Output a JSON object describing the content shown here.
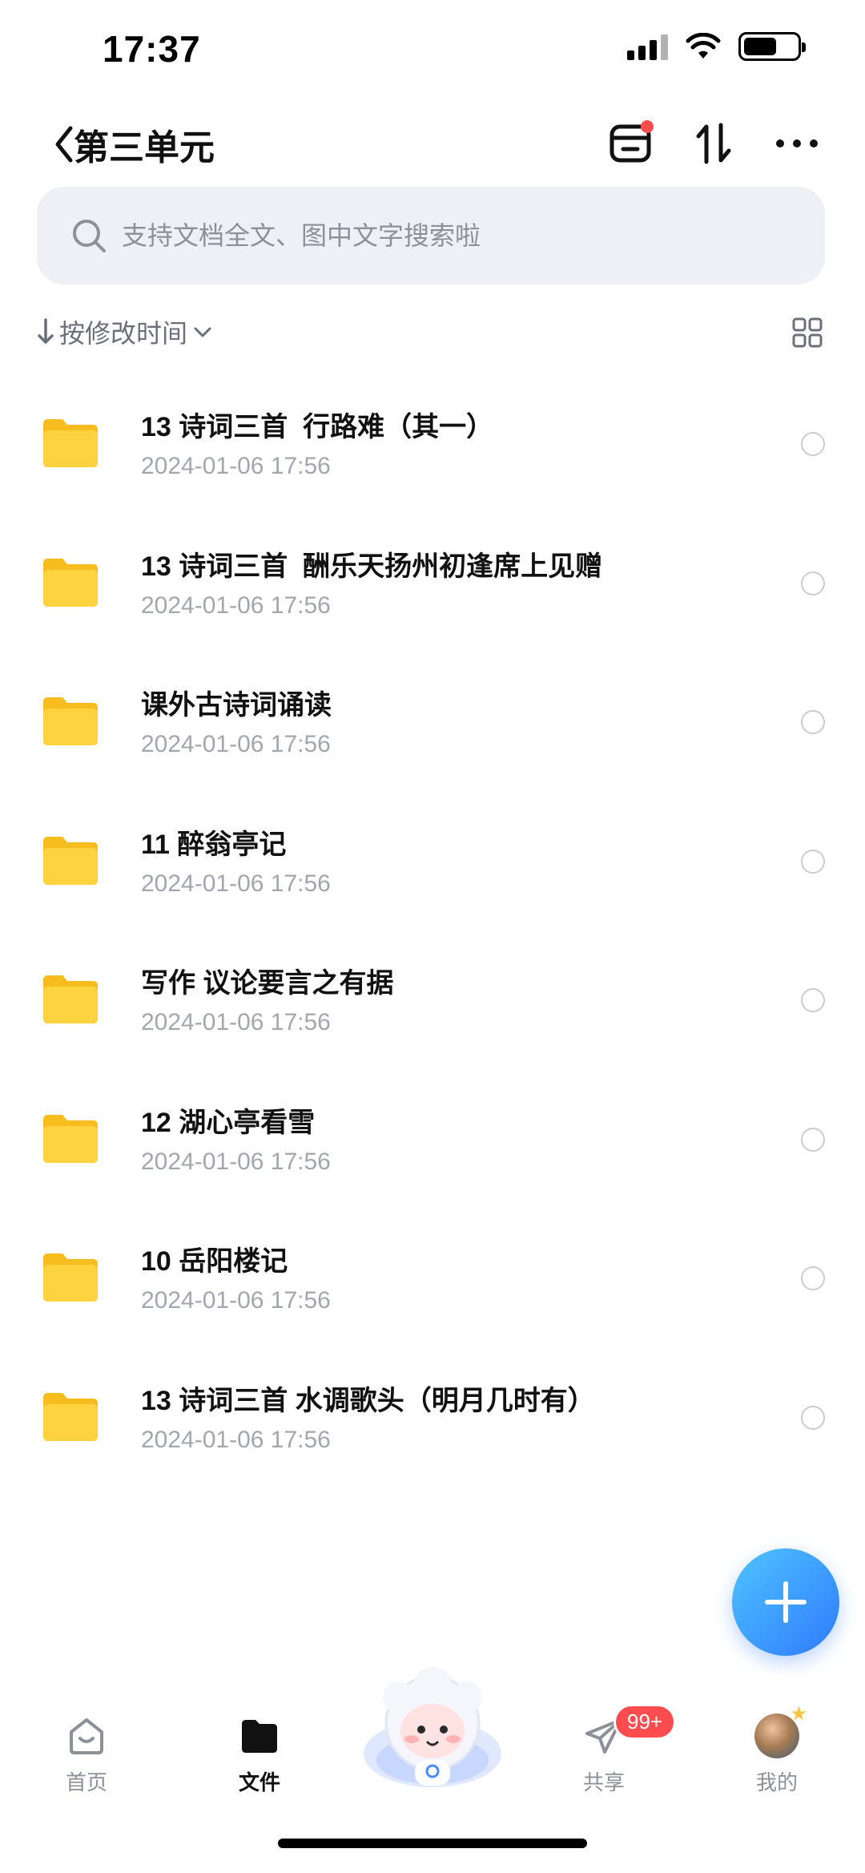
{
  "status_bar": {
    "time": "17:37",
    "battery_level": 0.62
  },
  "header": {
    "title": "第三单元"
  },
  "search": {
    "placeholder": "支持文档全文、图中文字搜索啦"
  },
  "sort": {
    "label": "按修改时间"
  },
  "files": [
    {
      "name": "13 诗词三首  行路难（其一）",
      "date": "2024-01-06 17:56"
    },
    {
      "name": "13 诗词三首  酬乐天扬州初逢席上见赠",
      "date": "2024-01-06 17:56"
    },
    {
      "name": "课外古诗词诵读",
      "date": "2024-01-06 17:56"
    },
    {
      "name": "11 醉翁亭记",
      "date": "2024-01-06 17:56"
    },
    {
      "name": "写作 议论要言之有据",
      "date": "2024-01-06 17:56"
    },
    {
      "name": "12 湖心亭看雪",
      "date": "2024-01-06 17:56"
    },
    {
      "name": "10 岳阳楼记",
      "date": "2024-01-06 17:56"
    },
    {
      "name": "13 诗词三首 水调歌头（明月几时有）",
      "date": "2024-01-06 17:56"
    }
  ],
  "tabs": [
    {
      "label": "首页",
      "icon": "home-icon"
    },
    {
      "label": "文件",
      "icon": "folder-icon",
      "active": true
    },
    {
      "label": "共享",
      "icon": "send-icon",
      "badge": "99+"
    },
    {
      "label": "我的",
      "icon": "avatar"
    }
  ],
  "colors": {
    "accent": "#2f7bff",
    "badge": "#ff4d4f",
    "folder": "#ffd23f"
  }
}
